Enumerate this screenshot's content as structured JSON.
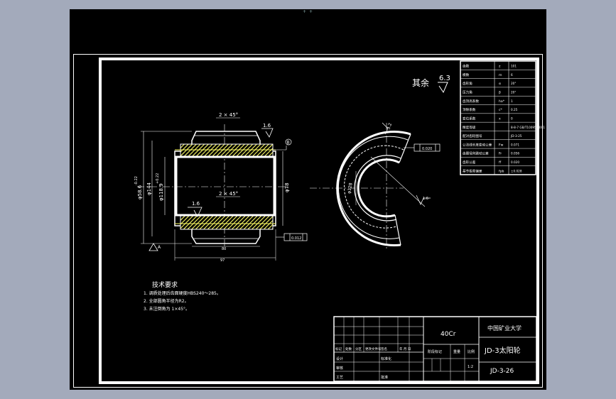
{
  "viewport": {
    "top_marker": "+ +"
  },
  "roughness": {
    "label": "其余",
    "value": "6.3"
  },
  "front_view": {
    "chamfer_top": "2 × 45°",
    "chamfer_mid": "2 × 45°",
    "rough_top": "1.6",
    "rough_bottom": "1.6",
    "dim_outer": "φ58.6",
    "dim_outer_tol": "-0.22",
    "dim_mid": "φ144",
    "dim_bore": "φ118.9",
    "dim_bore_tol": "+0.22",
    "dim_right": "φ78",
    "datum_right": "B",
    "tol_frame": "0.012",
    "datum_triangle": "A",
    "width_inner": "80",
    "width_outer": "97"
  },
  "side_view": {
    "tol_frame": "0.020",
    "rough_right": "1.6",
    "rough_top": "3.2",
    "dim_inner": "φ128"
  },
  "gear_table": {
    "rows": [
      {
        "name": "齿数",
        "sym": "z",
        "val": "101"
      },
      {
        "name": "模数",
        "sym": "m",
        "val": "6"
      },
      {
        "name": "齿形角",
        "sym": "α",
        "val": "20°"
      },
      {
        "name": "压力角",
        "sym": "β",
        "val": "20°"
      },
      {
        "name": "齿顶高系数",
        "sym": "ha*",
        "val": "1"
      },
      {
        "name": "顶隙系数",
        "sym": "c*",
        "val": "0.25"
      },
      {
        "name": "变位系数",
        "sym": "x",
        "val": "0"
      },
      {
        "name": "精度等级",
        "sym": "",
        "val": "8-8-7 GB/T10095-2001"
      },
      {
        "name": "配对齿轮图号",
        "sym": "",
        "val": "JD-3-25"
      },
      {
        "name": "公法线长度变动公差",
        "sym": "Fw",
        "val": "0.071"
      },
      {
        "name": "齿圈径向跳动公差",
        "sym": "Fr",
        "val": "0.056"
      },
      {
        "name": "齿形公差",
        "sym": "ff",
        "val": "0.020"
      },
      {
        "name": "基节极限偏差",
        "sym": "fpb",
        "val": "±0.028"
      }
    ]
  },
  "tech_notes": {
    "title": "技术要求",
    "items": [
      "1. 调质处理后齿面硬度HBS240～285。",
      "2. 全部圆角半径为R2。",
      "3. 未注倒角为 1×45°。"
    ]
  },
  "title_block": {
    "material": "40Cr",
    "school": "中国矿业大学",
    "part_name": "JD-3太阳轮",
    "drawing_no": "JD-3-26",
    "scale": "1:2",
    "row_labels": [
      "标记",
      "处数",
      "分区",
      "更改文件号",
      "签名",
      "年 月 日"
    ],
    "design": "设计",
    "standard": "标准化",
    "stage": "阶段标记",
    "weight": "重量",
    "ratio": "比例",
    "review": "审核",
    "process": "工艺",
    "approve": "批准"
  },
  "colors": {
    "background": "#000000",
    "line": "#ffffff",
    "hatch": "#ffff66",
    "chrome": "#a3aabb"
  }
}
